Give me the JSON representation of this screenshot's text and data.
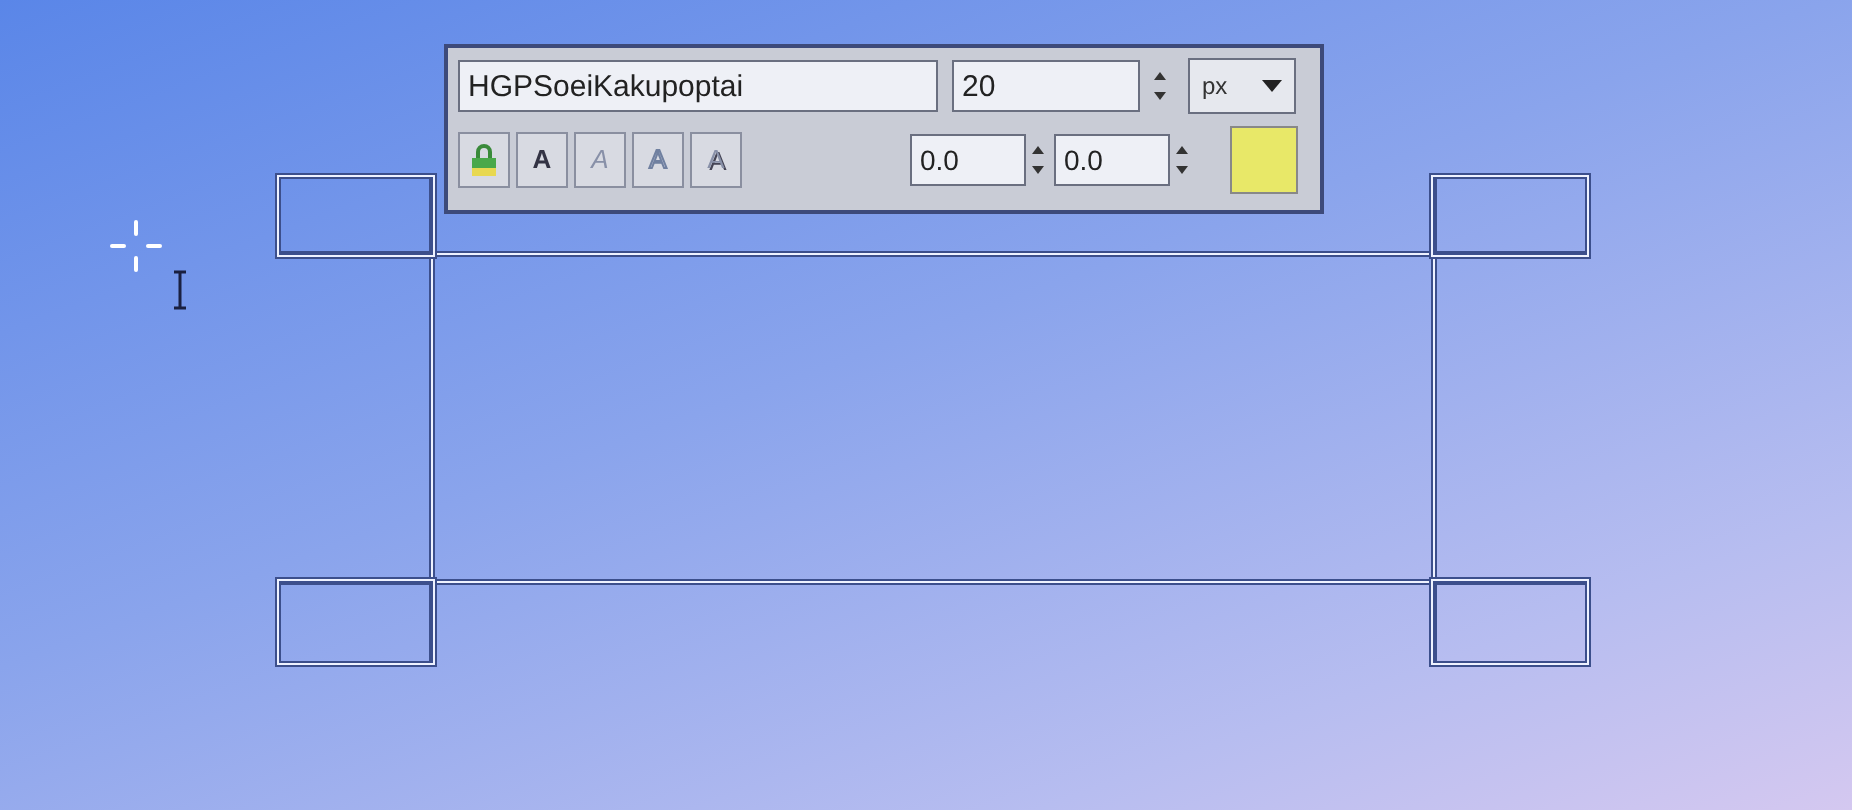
{
  "text_toolbar": {
    "font_field": {
      "value": "HGPSoeiKakupoptai"
    },
    "size_field": {
      "value": "20"
    },
    "unit_dropdown": {
      "value": "px"
    },
    "style_buttons": [
      {
        "kind": "lock"
      },
      {
        "kind": "bold",
        "label": "A"
      },
      {
        "kind": "italic",
        "label": "A"
      },
      {
        "kind": "outline",
        "label": "A"
      },
      {
        "kind": "shadow",
        "label": "A"
      }
    ],
    "offset_fields": [
      {
        "value": "0.0"
      },
      {
        "value": "0.0"
      }
    ],
    "color_swatch": {
      "color": "#e8e868"
    }
  }
}
